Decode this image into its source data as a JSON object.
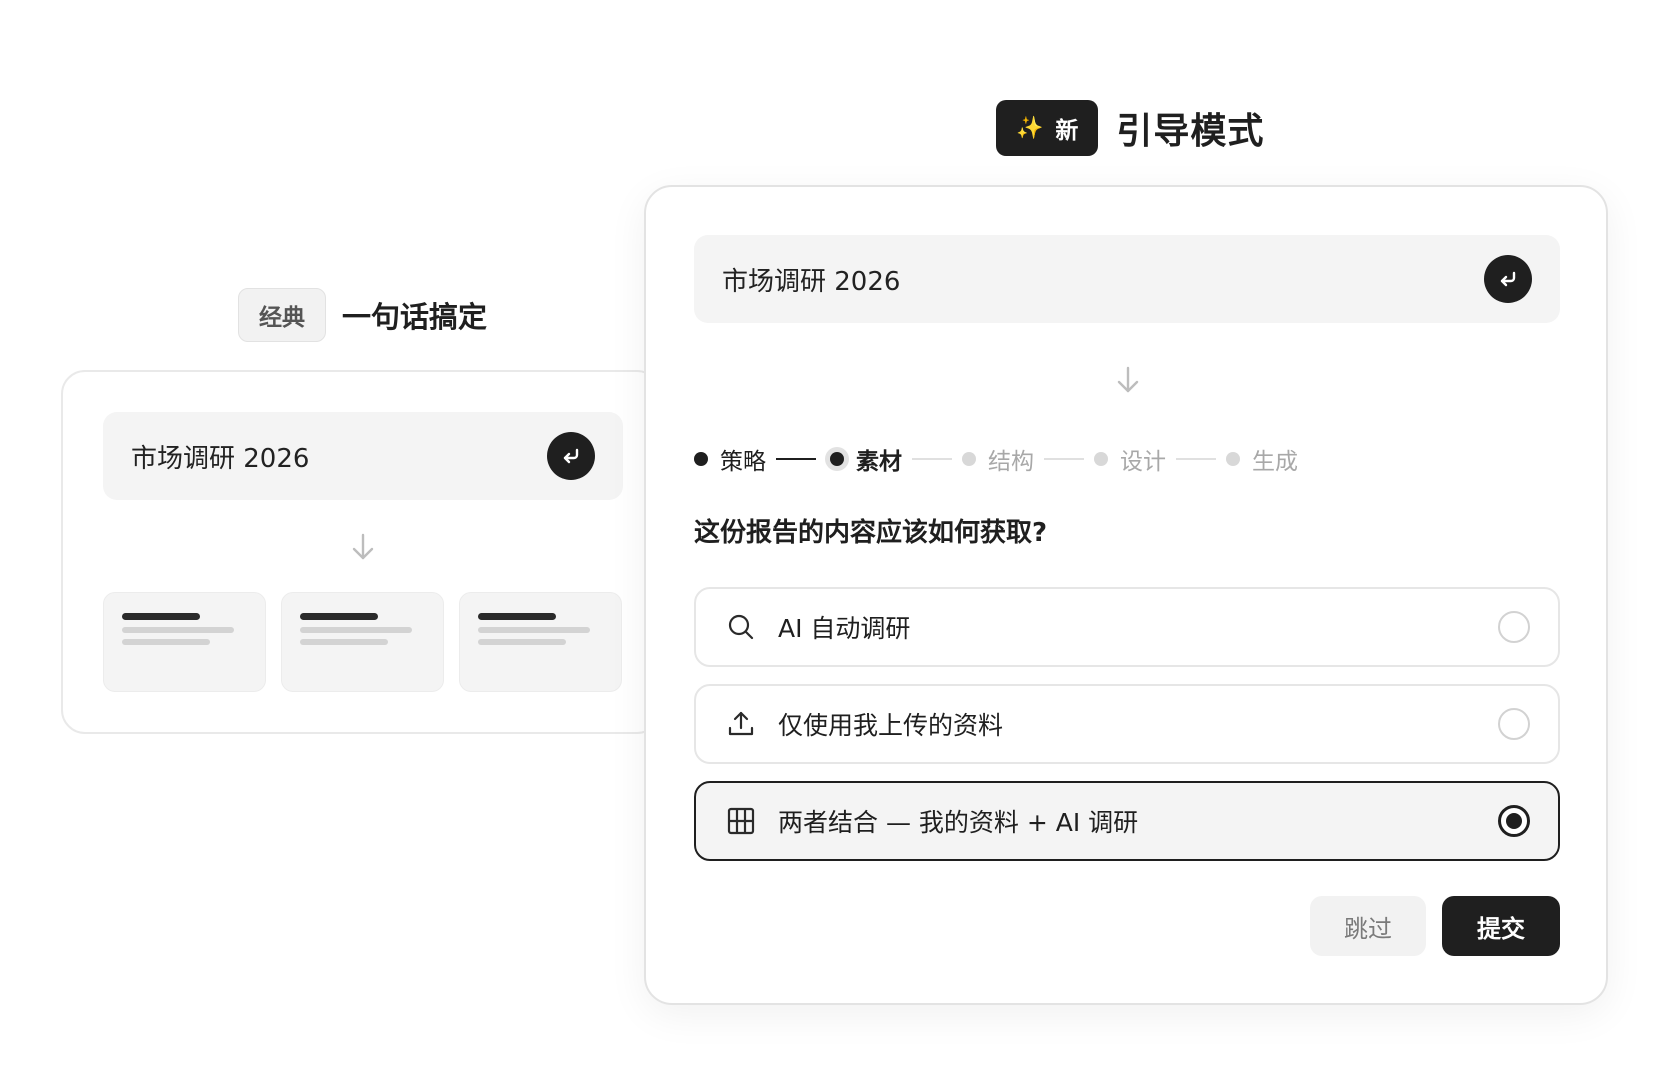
{
  "classic": {
    "badge": "经典",
    "title": "一句话搞定",
    "prompt": "市场调研 2026",
    "enter_icon": "enter-icon",
    "arrow_icon": "arrow-down-icon"
  },
  "guided": {
    "badge_icon": "sparkles-icon",
    "badge_sparkle": "✨",
    "badge": "新",
    "title": "引导模式",
    "prompt": "市场调研 2026",
    "steps": [
      {
        "label": "策略",
        "state": "done"
      },
      {
        "label": "素材",
        "state": "current"
      },
      {
        "label": "结构",
        "state": "pending"
      },
      {
        "label": "设计",
        "state": "pending"
      },
      {
        "label": "生成",
        "state": "pending"
      }
    ],
    "question": "这份报告的内容应该如何获取?",
    "options": [
      {
        "icon": "search-icon",
        "label": "AI 自动调研",
        "selected": false
      },
      {
        "icon": "upload-icon",
        "label": "仅使用我上传的资料",
        "selected": false
      },
      {
        "icon": "grid-icon",
        "label": "两者结合 — 我的资料 + AI 调研",
        "selected": true
      }
    ],
    "skip_label": "跳过",
    "submit_label": "提交"
  },
  "colors": {
    "primary": "#1f1f1f",
    "muted": "#a8a8a8",
    "surface": "#f4f4f4",
    "accent_sparkle": "#f5c518"
  }
}
